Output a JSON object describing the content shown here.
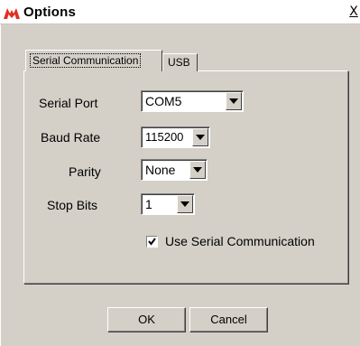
{
  "window": {
    "title": "Options",
    "icon": "microchip-logo-icon",
    "close_label": "X"
  },
  "tabs": [
    {
      "label": "Serial Communication",
      "active": true
    },
    {
      "label": "USB",
      "active": false
    }
  ],
  "fields": {
    "serial_port": {
      "label": "Serial Port",
      "value": "COM5"
    },
    "baud_rate": {
      "label": "Baud Rate",
      "value": "115200"
    },
    "parity": {
      "label": "Parity",
      "value": "None"
    },
    "stop_bits": {
      "label": "Stop Bits",
      "value": "1"
    }
  },
  "use_serial": {
    "label": "Use Serial Communication",
    "checked": true
  },
  "buttons": {
    "ok": "OK",
    "cancel": "Cancel"
  },
  "colors": {
    "face": "#d4d0c8",
    "logo": "#e03020"
  }
}
